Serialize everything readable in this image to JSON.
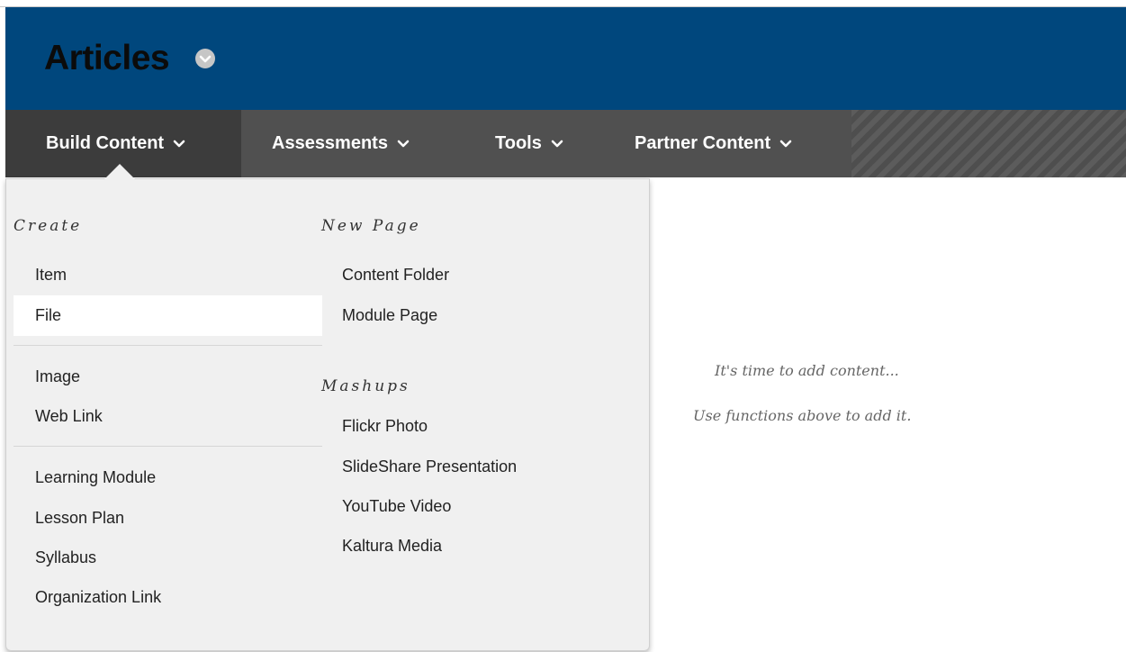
{
  "header": {
    "title": "Articles",
    "bg_color": "#00477d"
  },
  "navbar": {
    "items": [
      {
        "label": "Build Content"
      },
      {
        "label": "Assessments"
      },
      {
        "label": "Tools"
      },
      {
        "label": "Partner Content"
      }
    ]
  },
  "dropdown": {
    "create": {
      "heading": "Create",
      "items": [
        "Item",
        "File",
        "Image",
        "Web Link",
        "Learning Module",
        "Lesson Plan",
        "Syllabus",
        "Organization Link"
      ],
      "highlighted": "File"
    },
    "new_page": {
      "heading": "New Page",
      "items": [
        "Content Folder",
        "Module Page"
      ]
    },
    "mashups": {
      "heading": "Mashups",
      "items": [
        "Flickr Photo",
        "SlideShare Presentation",
        "YouTube Video",
        "Kaltura Media"
      ]
    }
  },
  "empty_state": {
    "line1": "It's time to add content...",
    "line2": "Use functions above to add it."
  }
}
